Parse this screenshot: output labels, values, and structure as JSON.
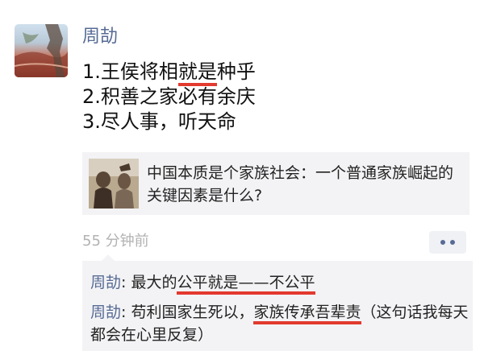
{
  "post": {
    "author": "周劼",
    "lines": {
      "l1a": "1.王侯将相",
      "l1b": "就是",
      "l1c": "种乎",
      "l2": "2.积善之家必有余庆",
      "l3": "3.尽人事，听天命"
    },
    "link": {
      "title": "中国本质是个家族社会：一个普通家族崛起的关键因素是什么?"
    },
    "timestamp": "55 分钟前",
    "more_icon": "ellipsis-icon"
  },
  "comments": {
    "c1": {
      "author": "周劼",
      "sep": ": ",
      "a": "最大的",
      "b": "公平就是——不公平"
    },
    "c2": {
      "author": "周劼",
      "sep": ": ",
      "a": "苟利国家生死以，",
      "b": "家族传承吾辈责",
      "c": "（这句话我每天都会在心里反复）"
    }
  },
  "colors": {
    "name_blue": "#576b95",
    "underline_red": "#e23a2e",
    "card_bg": "#f3f3f5"
  }
}
